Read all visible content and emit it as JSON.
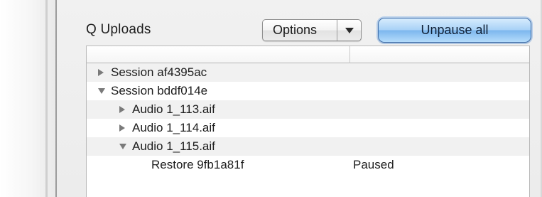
{
  "panel": {
    "title": "Q Uploads",
    "options_label": "Options",
    "unpause_label": "Unpause all"
  },
  "outline": {
    "rows": [
      {
        "label": "Session af4395ac",
        "expanded": false,
        "status": ""
      },
      {
        "label": "Session bddf014e",
        "expanded": true,
        "status": ""
      },
      {
        "label": "Audio 1_113.aif",
        "expanded": false,
        "status": ""
      },
      {
        "label": "Audio 1_114.aif",
        "expanded": false,
        "status": ""
      },
      {
        "label": "Audio 1_115.aif",
        "expanded": true,
        "status": ""
      },
      {
        "label": "Restore 9fb1a81f",
        "expanded": null,
        "status": "Paused"
      }
    ]
  },
  "icons": {
    "disclosure_collapsed": "triangle-right-icon",
    "disclosure_expanded": "triangle-down-icon",
    "dropdown": "chevron-down-icon"
  },
  "colors": {
    "accent_button": "#a9d2f7",
    "row_alt": "#f1f1f1",
    "panel_bg": "#ececec"
  }
}
